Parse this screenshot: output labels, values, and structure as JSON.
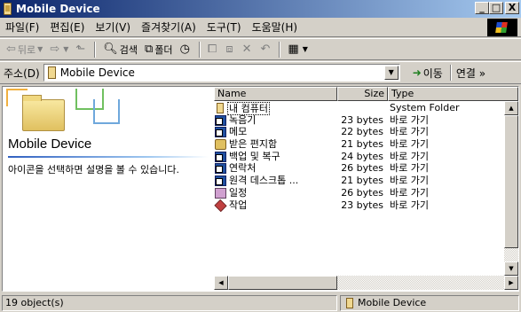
{
  "window": {
    "title": "Mobile Device",
    "controls": {
      "minimize": "_",
      "maximize": "□",
      "close": "X"
    }
  },
  "menu": [
    "파일(F)",
    "편집(E)",
    "보기(V)",
    "즐겨찾기(A)",
    "도구(T)",
    "도움말(H)"
  ],
  "toolbar": {
    "back": "뒤로",
    "search": "검색",
    "folders": "폴더"
  },
  "address": {
    "label": "주소(D)",
    "value": "Mobile Device",
    "go": "이동",
    "links": "연결 »"
  },
  "left_pane": {
    "title": "Mobile Device",
    "description": "아이콘을 선택하면 설명을 볼 수 있습니다."
  },
  "columns": {
    "name": "Name",
    "size": "Size",
    "type": "Type"
  },
  "files": [
    {
      "name": "내 컴퓨터",
      "size": "",
      "type": "System Folder",
      "icon": "device-icon"
    },
    {
      "name": "녹음기",
      "size": "23 bytes",
      "type": "바로 가기",
      "icon": "shortcut-icon"
    },
    {
      "name": "메모",
      "size": "22 bytes",
      "type": "바로 가기",
      "icon": "shortcut-icon"
    },
    {
      "name": "받은 편지함",
      "size": "21 bytes",
      "type": "바로 가기",
      "icon": "inbox-icon"
    },
    {
      "name": "백업 및 복구",
      "size": "24 bytes",
      "type": "바로 가기",
      "icon": "shortcut-icon"
    },
    {
      "name": "연락처",
      "size": "26 bytes",
      "type": "바로 가기",
      "icon": "shortcut-icon"
    },
    {
      "name": "원격 데스크톱 ...",
      "size": "21 bytes",
      "type": "바로 가기",
      "icon": "shortcut-icon"
    },
    {
      "name": "일정",
      "size": "26 bytes",
      "type": "바로 가기",
      "icon": "calendar-icon"
    },
    {
      "name": "작업",
      "size": "23 bytes",
      "type": "바로 가기",
      "icon": "task-icon"
    }
  ],
  "status": {
    "count": "19 object(s)",
    "location": "Mobile Device"
  }
}
